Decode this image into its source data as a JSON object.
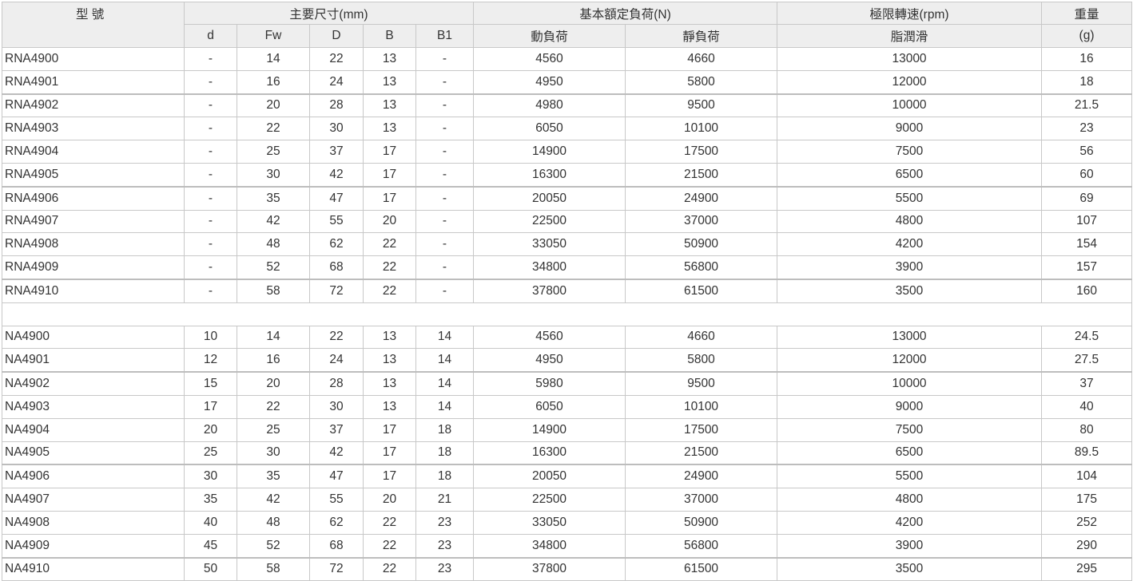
{
  "header": {
    "model": "型 號",
    "main_dims": "主要尺寸(mm)",
    "load": "基本額定負荷(N)",
    "speed": "極限轉速(rpm)",
    "weight": "重量",
    "d": "d",
    "fw": "Fw",
    "D": "D",
    "B": "B",
    "b1": "B1",
    "dynamic": "動負荷",
    "static": "靜負荷",
    "grease": "脂潤滑",
    "gram": "(g)"
  },
  "rna": [
    {
      "model": "RNA4900",
      "d": "-",
      "fw": "14",
      "D": "22",
      "B": "13",
      "b1": "-",
      "dyn": "4560",
      "stat": "4660",
      "rpm": "13000",
      "wt": "16"
    },
    {
      "model": "RNA4901",
      "d": "-",
      "fw": "16",
      "D": "24",
      "B": "13",
      "b1": "-",
      "dyn": "4950",
      "stat": "5800",
      "rpm": "12000",
      "wt": "18"
    },
    {
      "model": "RNA4902",
      "d": "-",
      "fw": "20",
      "D": "28",
      "B": "13",
      "b1": "-",
      "dyn": "4980",
      "stat": "9500",
      "rpm": "10000",
      "wt": "21.5"
    },
    {
      "model": "RNA4903",
      "d": "-",
      "fw": "22",
      "D": "30",
      "B": "13",
      "b1": "-",
      "dyn": "6050",
      "stat": "10100",
      "rpm": "9000",
      "wt": "23"
    },
    {
      "model": "RNA4904",
      "d": "-",
      "fw": "25",
      "D": "37",
      "B": "17",
      "b1": "-",
      "dyn": "14900",
      "stat": "17500",
      "rpm": "7500",
      "wt": "56"
    },
    {
      "model": "RNA4905",
      "d": "-",
      "fw": "30",
      "D": "42",
      "B": "17",
      "b1": "-",
      "dyn": "16300",
      "stat": "21500",
      "rpm": "6500",
      "wt": "60"
    },
    {
      "model": "RNA4906",
      "d": "-",
      "fw": "35",
      "D": "47",
      "B": "17",
      "b1": "-",
      "dyn": "20050",
      "stat": "24900",
      "rpm": "5500",
      "wt": "69"
    },
    {
      "model": "RNA4907",
      "d": "-",
      "fw": "42",
      "D": "55",
      "B": "20",
      "b1": "-",
      "dyn": "22500",
      "stat": "37000",
      "rpm": "4800",
      "wt": "107"
    },
    {
      "model": "RNA4908",
      "d": "-",
      "fw": "48",
      "D": "62",
      "B": "22",
      "b1": "-",
      "dyn": "33050",
      "stat": "50900",
      "rpm": "4200",
      "wt": "154"
    },
    {
      "model": "RNA4909",
      "d": "-",
      "fw": "52",
      "D": "68",
      "B": "22",
      "b1": "-",
      "dyn": "34800",
      "stat": "56800",
      "rpm": "3900",
      "wt": "157"
    },
    {
      "model": "RNA4910",
      "d": "-",
      "fw": "58",
      "D": "72",
      "B": "22",
      "b1": "-",
      "dyn": "37800",
      "stat": "61500",
      "rpm": "3500",
      "wt": "160"
    }
  ],
  "na": [
    {
      "model": "NA4900",
      "d": "10",
      "fw": "14",
      "D": "22",
      "B": "13",
      "b1": "14",
      "dyn": "4560",
      "stat": "4660",
      "rpm": "13000",
      "wt": "24.5"
    },
    {
      "model": "NA4901",
      "d": "12",
      "fw": "16",
      "D": "24",
      "B": "13",
      "b1": "14",
      "dyn": "4950",
      "stat": "5800",
      "rpm": "12000",
      "wt": "27.5"
    },
    {
      "model": "NA4902",
      "d": "15",
      "fw": "20",
      "D": "28",
      "B": "13",
      "b1": "14",
      "dyn": "5980",
      "stat": "9500",
      "rpm": "10000",
      "wt": "37"
    },
    {
      "model": "NA4903",
      "d": "17",
      "fw": "22",
      "D": "30",
      "B": "13",
      "b1": "14",
      "dyn": "6050",
      "stat": "10100",
      "rpm": "9000",
      "wt": "40"
    },
    {
      "model": "NA4904",
      "d": "20",
      "fw": "25",
      "D": "37",
      "B": "17",
      "b1": "18",
      "dyn": "14900",
      "stat": "17500",
      "rpm": "7500",
      "wt": "80"
    },
    {
      "model": "NA4905",
      "d": "25",
      "fw": "30",
      "D": "42",
      "B": "17",
      "b1": "18",
      "dyn": "16300",
      "stat": "21500",
      "rpm": "6500",
      "wt": "89.5"
    },
    {
      "model": "NA4906",
      "d": "30",
      "fw": "35",
      "D": "47",
      "B": "17",
      "b1": "18",
      "dyn": "20050",
      "stat": "24900",
      "rpm": "5500",
      "wt": "104"
    },
    {
      "model": "NA4907",
      "d": "35",
      "fw": "42",
      "D": "55",
      "B": "20",
      "b1": "21",
      "dyn": "22500",
      "stat": "37000",
      "rpm": "4800",
      "wt": "175"
    },
    {
      "model": "NA4908",
      "d": "40",
      "fw": "48",
      "D": "62",
      "B": "22",
      "b1": "23",
      "dyn": "33050",
      "stat": "50900",
      "rpm": "4200",
      "wt": "252"
    },
    {
      "model": "NA4909",
      "d": "45",
      "fw": "52",
      "D": "68",
      "B": "22",
      "b1": "23",
      "dyn": "34800",
      "stat": "56800",
      "rpm": "3900",
      "wt": "290"
    },
    {
      "model": "NA4910",
      "d": "50",
      "fw": "58",
      "D": "72",
      "B": "22",
      "b1": "23",
      "dyn": "37800",
      "stat": "61500",
      "rpm": "3500",
      "wt": "295"
    }
  ]
}
